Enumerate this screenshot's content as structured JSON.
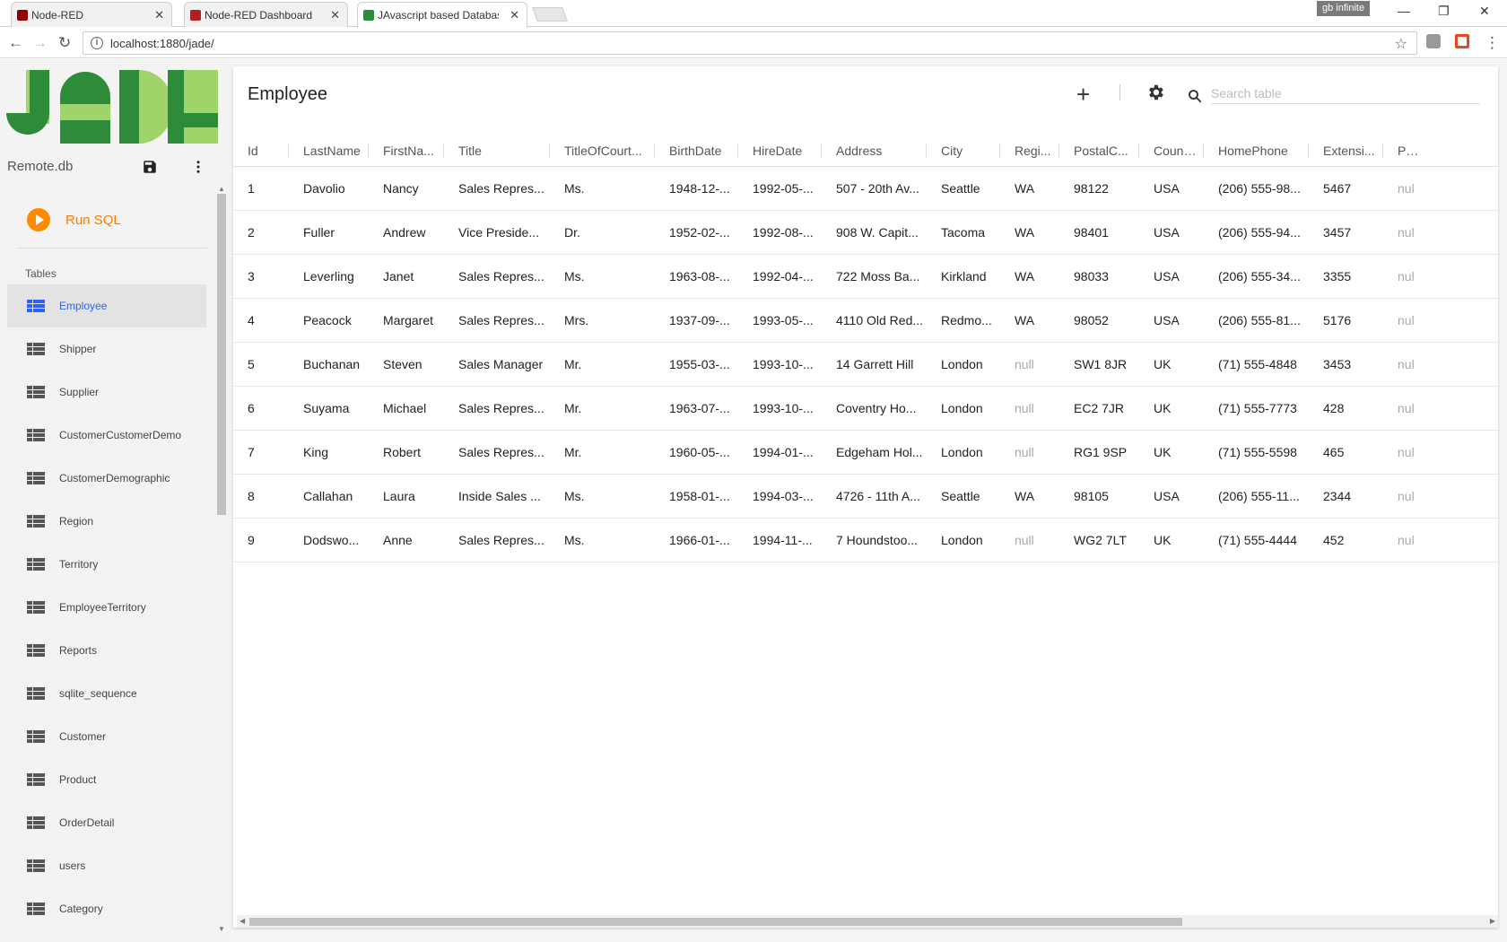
{
  "browser": {
    "tabs": [
      {
        "title": "Node-RED",
        "active": false
      },
      {
        "title": "Node-RED Dashboard",
        "active": false
      },
      {
        "title": "JAvascript based Databas",
        "active": true
      }
    ],
    "profile": "gb infinite",
    "url": "localhost:1880/jade/"
  },
  "sidebar": {
    "logo_text": "JADE",
    "db_name": "Remote.db",
    "run_sql_label": "Run SQL",
    "tables_header": "Tables",
    "tables": [
      "Employee",
      "Shipper",
      "Supplier",
      "CustomerCustomerDemo",
      "CustomerDemographic",
      "Region",
      "Territory",
      "EmployeeTerritory",
      "Reports",
      "sqlite_sequence",
      "Customer",
      "Product",
      "OrderDetail",
      "users",
      "Category"
    ],
    "active_table": "Employee"
  },
  "main": {
    "title": "Employee",
    "search_placeholder": "Search table",
    "columns": [
      "Id",
      "LastName",
      "FirstNa...",
      "Title",
      "TitleOfCourt...",
      "BirthDate",
      "HireDate",
      "Address",
      "City",
      "Regi...",
      "PostalC...",
      "Count...",
      "HomePhone",
      "Extensi...",
      "Pho"
    ],
    "rows": [
      [
        "1",
        "Davolio",
        "Nancy",
        "Sales Repres...",
        "Ms.",
        "1948-12-...",
        "1992-05-...",
        "507 - 20th Av...",
        "Seattle",
        "WA",
        "98122",
        "USA",
        "(206) 555-98...",
        "5467",
        "nul"
      ],
      [
        "2",
        "Fuller",
        "Andrew",
        "Vice Preside...",
        "Dr.",
        "1952-02-...",
        "1992-08-...",
        "908 W. Capit...",
        "Tacoma",
        "WA",
        "98401",
        "USA",
        "(206) 555-94...",
        "3457",
        "nul"
      ],
      [
        "3",
        "Leverling",
        "Janet",
        "Sales Repres...",
        "Ms.",
        "1963-08-...",
        "1992-04-...",
        "722 Moss Ba...",
        "Kirkland",
        "WA",
        "98033",
        "USA",
        "(206) 555-34...",
        "3355",
        "nul"
      ],
      [
        "4",
        "Peacock",
        "Margaret",
        "Sales Repres...",
        "Mrs.",
        "1937-09-...",
        "1993-05-...",
        "4110 Old Red...",
        "Redmo...",
        "WA",
        "98052",
        "USA",
        "(206) 555-81...",
        "5176",
        "nul"
      ],
      [
        "5",
        "Buchanan",
        "Steven",
        "Sales Manager",
        "Mr.",
        "1955-03-...",
        "1993-10-...",
        "14 Garrett Hill",
        "London",
        "null",
        "SW1 8JR",
        "UK",
        "(71) 555-4848",
        "3453",
        "nul"
      ],
      [
        "6",
        "Suyama",
        "Michael",
        "Sales Repres...",
        "Mr.",
        "1963-07-...",
        "1993-10-...",
        "Coventry Ho...",
        "London",
        "null",
        "EC2 7JR",
        "UK",
        "(71) 555-7773",
        "428",
        "nul"
      ],
      [
        "7",
        "King",
        "Robert",
        "Sales Repres...",
        "Mr.",
        "1960-05-...",
        "1994-01-...",
        "Edgeham Hol...",
        "London",
        "null",
        "RG1 9SP",
        "UK",
        "(71) 555-5598",
        "465",
        "nul"
      ],
      [
        "8",
        "Callahan",
        "Laura",
        "Inside Sales ...",
        "Ms.",
        "1958-01-...",
        "1994-03-...",
        "4726 - 11th A...",
        "Seattle",
        "WA",
        "98105",
        "USA",
        "(206) 555-11...",
        "2344",
        "nul"
      ],
      [
        "9",
        "Dodswo...",
        "Anne",
        "Sales Repres...",
        "Ms.",
        "1966-01-...",
        "1994-11-...",
        "7 Houndstoo...",
        "London",
        "null",
        "WG2 7LT",
        "UK",
        "(71) 555-4444",
        "452",
        "nul"
      ]
    ]
  },
  "colors": {
    "accent_orange": "#ff7a00",
    "selected_blue": "#2962ff",
    "logo_green_dark": "#2e8b3a",
    "logo_green_light": "#9fd46b"
  }
}
